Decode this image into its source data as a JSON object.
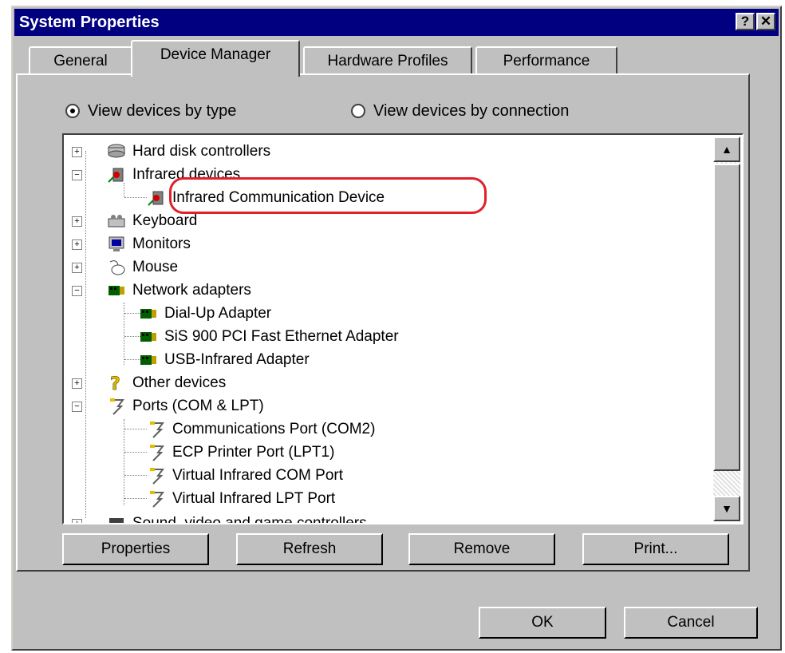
{
  "window": {
    "title": "System Properties",
    "help_label": "?",
    "close_label": "✕"
  },
  "tabs": [
    {
      "label": "General"
    },
    {
      "label": "Device Manager"
    },
    {
      "label": "Hardware Profiles"
    },
    {
      "label": "Performance"
    }
  ],
  "view_options": {
    "by_type": "View devices by type",
    "by_connection": "View devices by connection",
    "selected": "by_type"
  },
  "devices": [
    {
      "label": "Hard disk controllers",
      "level": 0,
      "expander": "+",
      "icon": "disk-controller-icon"
    },
    {
      "label": "Infrared devices",
      "level": 0,
      "expander": "-",
      "icon": "infrared-icon"
    },
    {
      "label": "Infrared Communication Device",
      "level": 1,
      "icon": "infrared-icon"
    },
    {
      "label": "Keyboard",
      "level": 0,
      "expander": "+",
      "icon": "keyboard-icon"
    },
    {
      "label": "Monitors",
      "level": 0,
      "expander": "+",
      "icon": "monitor-icon"
    },
    {
      "label": "Mouse",
      "level": 0,
      "expander": "+",
      "icon": "mouse-icon"
    },
    {
      "label": "Network adapters",
      "level": 0,
      "expander": "-",
      "icon": "network-adapter-icon"
    },
    {
      "label": "Dial-Up Adapter",
      "level": 1,
      "icon": "network-adapter-icon"
    },
    {
      "label": "SiS 900 PCI Fast Ethernet Adapter",
      "level": 1,
      "icon": "network-adapter-icon"
    },
    {
      "label": "USB-Infrared Adapter",
      "level": 1,
      "icon": "network-adapter-icon"
    },
    {
      "label": "Other devices",
      "level": 0,
      "expander": "+",
      "icon": "question-icon"
    },
    {
      "label": "Ports (COM & LPT)",
      "level": 0,
      "expander": "-",
      "icon": "port-icon"
    },
    {
      "label": "Communications Port (COM2)",
      "level": 1,
      "icon": "port-icon"
    },
    {
      "label": "ECP Printer Port (LPT1)",
      "level": 1,
      "icon": "port-icon"
    },
    {
      "label": "Virtual Infrared COM Port",
      "level": 1,
      "icon": "port-icon"
    },
    {
      "label": "Virtual Infrared LPT Port",
      "level": 1,
      "icon": "port-icon"
    },
    {
      "label": "Sound, video and game controllers",
      "level": 0,
      "expander": "+",
      "icon": "sound-icon"
    }
  ],
  "buttons": {
    "properties": "Properties",
    "refresh": "Refresh",
    "remove": "Remove",
    "print": "Print...",
    "ok": "OK",
    "cancel": "Cancel"
  },
  "colors": {
    "title_bar": "#000080",
    "face": "#c0c0c0",
    "highlight_ring": "#e0202a"
  }
}
